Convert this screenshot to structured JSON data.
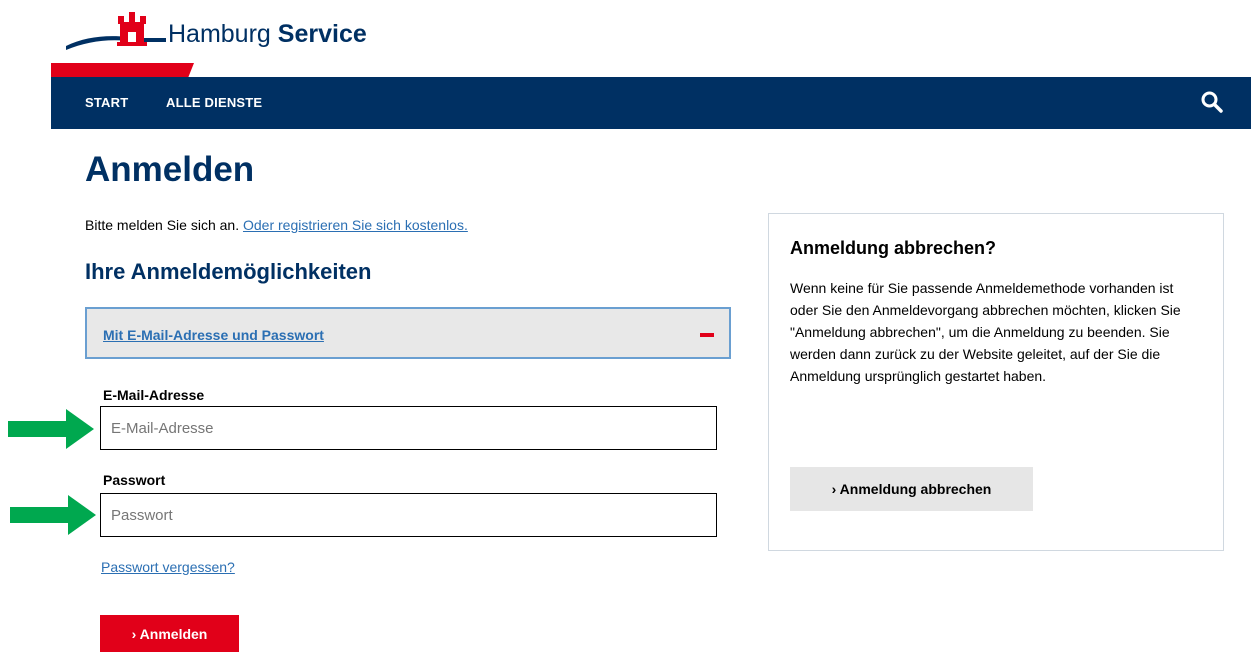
{
  "header": {
    "brand_prefix": "Hamburg",
    "brand_bold": "Service",
    "nav": [
      {
        "label": "START"
      },
      {
        "label": "ALLE DIENSTE"
      }
    ]
  },
  "main": {
    "title": "Anmelden",
    "intro_text": "Bitte melden Sie sich an.",
    "register_link": "Oder registrieren Sie sich kostenlos.",
    "options_title": "Ihre Anmeldemöglichkeiten",
    "accordion_label": "Mit E-Mail-Adresse und Passwort",
    "email_label": "E-Mail-Adresse",
    "email_placeholder": "E-Mail-Adresse",
    "email_value": "",
    "password_label": "Passwort",
    "password_placeholder": "Passwort",
    "password_value": "",
    "forgot_link": "Passwort vergessen?",
    "submit_label": "› Anmelden"
  },
  "sidebar": {
    "title": "Anmeldung abbrechen?",
    "text": "Wenn keine für Sie passende Anmeldemethode vorhanden ist oder Sie den Anmeldevorgang abbrechen möchten, klicken Sie \"Anmeldung abbrechen\", um die Anmeldung zu beenden. Sie werden dann zurück zu der Website geleitet, auf der Sie die Anmeldung ursprünglich gestartet haben.",
    "cancel_label": "› Anmeldung abbrechen"
  },
  "colors": {
    "navy": "#003063",
    "red": "#e10019",
    "link": "#2b6fb3",
    "arrow_green": "#00a84f"
  },
  "icons": {
    "logo": "hamburg-castle-icon",
    "search": "search-icon",
    "collapse": "minus-icon",
    "annotation": "arrow-right-icon"
  }
}
